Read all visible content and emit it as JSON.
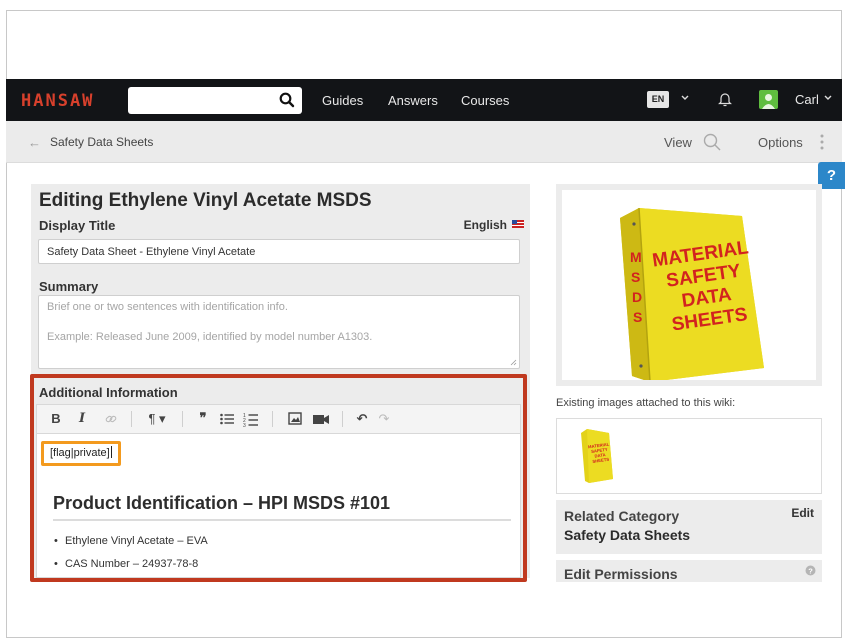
{
  "nav": {
    "logo": "HANSAW",
    "search_placeholder": "",
    "links": [
      "Guides",
      "Answers",
      "Courses"
    ],
    "language": "EN",
    "user_name": "Carl"
  },
  "subbar": {
    "breadcrumb": "Safety Data Sheets",
    "view_label": "View",
    "options_label": "Options"
  },
  "help_label": "?",
  "editor": {
    "title": "Editing Ethylene Vinyl Acetate MSDS",
    "display_title_label": "Display Title",
    "language_label": "English",
    "display_title_value": "Safety Data Sheet - Ethylene Vinyl Acetate",
    "summary_label": "Summary",
    "summary_placeholder_line1": "Brief one or two sentences with identification info.",
    "summary_placeholder_line2": "Example: Released June 2009, identified by model number A1303.",
    "additional_label": "Additional Information",
    "flag_token": "[flag|private]",
    "doc_heading": "Product Identification – HPI MSDS #101",
    "bullets": [
      "Ethylene Vinyl Acetate – EVA",
      "CAS Number – 24937-78-8"
    ]
  },
  "binder": {
    "spine_letters": [
      "M",
      "S",
      "D",
      "S"
    ],
    "cover_lines": [
      "MATERIAL",
      "SAFETY",
      "DATA",
      "SHEETS"
    ]
  },
  "sidebar": {
    "existing_images_label": "Existing images attached to this wiki:",
    "related_category_label": "Related Category",
    "related_category_value": "Safety Data Sheets",
    "edit_label": "Edit",
    "permissions_label": "Edit Permissions"
  },
  "colors": {
    "highlight_red": "#c0391f",
    "highlight_orange": "#f39a1e",
    "binder_yellow": "#e8d81c",
    "binder_text_red": "#d2231f",
    "help_blue": "#2c87c9"
  }
}
